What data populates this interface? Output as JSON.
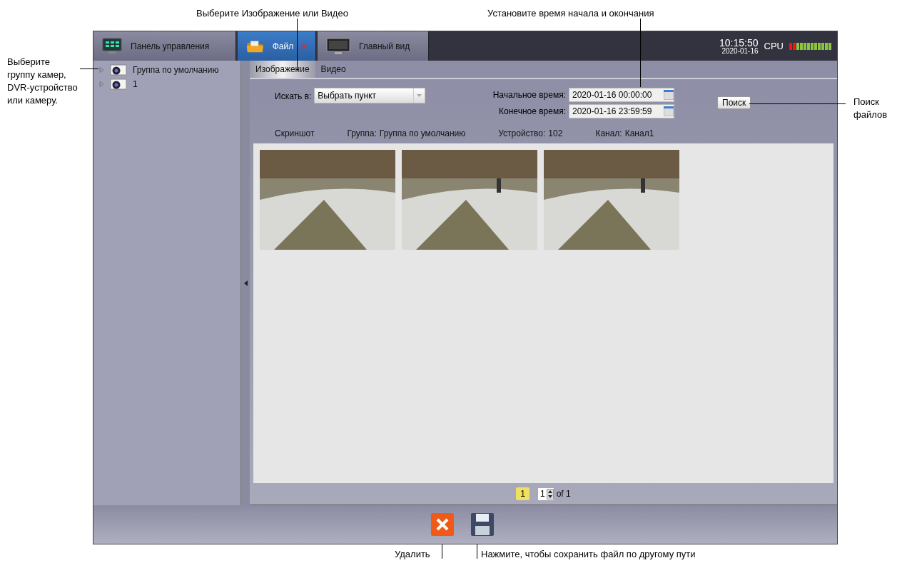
{
  "annotations": [
    {
      "kind": "top",
      "text": "Выберите Изображение или Видео"
    },
    {
      "kind": "top",
      "text": "Установите время начала и окончания"
    },
    {
      "kind": "left",
      "text": "Выберите группу камер, DVR-устройство или камеру."
    },
    {
      "kind": "right",
      "text": "Поиск файлов"
    },
    {
      "kind": "bottom",
      "text": "Удалить"
    },
    {
      "kind": "bottom",
      "text": "Нажмите, чтобы сохранить файл по другому пути"
    }
  ],
  "tabs": [
    {
      "kind": "panel",
      "label": "Панель управления",
      "selected": false,
      "closable": false
    },
    {
      "kind": "file",
      "label": "Файл",
      "selected": true,
      "closable": true
    },
    {
      "kind": "view",
      "label": "Главный вид",
      "selected": false,
      "closable": false
    }
  ],
  "clock": {
    "time": "10:15:50",
    "date": "2020-01-16"
  },
  "cpu": {
    "label": "CPU",
    "level": 0.17
  },
  "tree": [
    {
      "label": "Группа по умолчанию",
      "expanded": false
    },
    {
      "label": "1",
      "expanded": false
    }
  ],
  "subtabs": [
    {
      "label": "Изображение",
      "selected": true
    },
    {
      "label": "Видео",
      "selected": false
    }
  ],
  "filters": {
    "search_in": {
      "label": "Искать в:",
      "value": "Выбрать пункт"
    },
    "start_time": {
      "label": "Начальное время:",
      "value": "2020-01-16 00:00:00"
    },
    "end_time": {
      "label": "Конечное время:",
      "value": "2020-01-16 23:59:59"
    },
    "search_button": "Поиск"
  },
  "info": [
    {
      "label": "Скриншот"
    },
    {
      "label": "Группа:",
      "value": "Группа по умолчанию"
    },
    {
      "label": "Устройство:",
      "value": "102"
    },
    {
      "label": "Канал:",
      "value": "Канал1"
    }
  ],
  "thumbnails": [
    {
      "kind": "photo"
    },
    {
      "kind": "photo"
    },
    {
      "kind": "photo"
    }
  ],
  "pagination": {
    "current": "1",
    "page_field": "1",
    "of": "of 1"
  }
}
